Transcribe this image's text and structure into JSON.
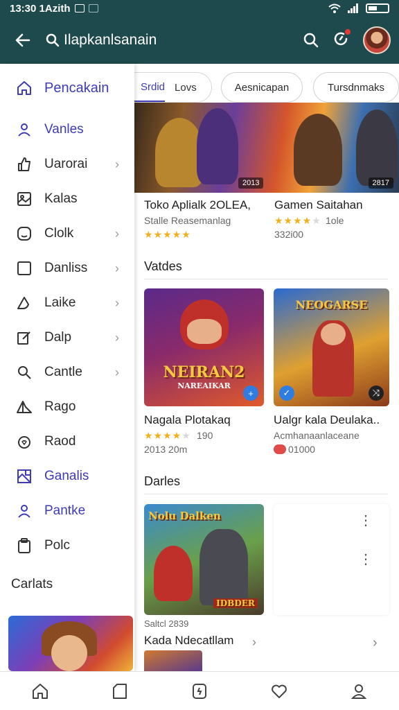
{
  "status_bar": {
    "time": "13:30 1Azith"
  },
  "app_bar": {
    "title": "Ilapkanlsanain"
  },
  "drawer": {
    "header_label": "Pencakain",
    "items": [
      {
        "label": "Vanles",
        "active": true,
        "chevron": false,
        "icon": "person-icon"
      },
      {
        "label": "Uarorai",
        "active": false,
        "chevron": true,
        "icon": "thumb-icon"
      },
      {
        "label": "Kalas",
        "active": false,
        "chevron": false,
        "icon": "image-icon"
      },
      {
        "label": "Clolk",
        "active": false,
        "chevron": true,
        "icon": "face-icon"
      },
      {
        "label": "Danliss",
        "active": false,
        "chevron": true,
        "icon": "square-icon"
      },
      {
        "label": "Laike",
        "active": false,
        "chevron": true,
        "icon": "leaf-icon"
      },
      {
        "label": "Dalp",
        "active": false,
        "chevron": true,
        "icon": "edit-icon"
      },
      {
        "label": "Cantle",
        "active": false,
        "chevron": true,
        "icon": "search-icon"
      },
      {
        "label": "Rago",
        "active": false,
        "chevron": false,
        "icon": "triangle-icon"
      },
      {
        "label": "Raod",
        "active": false,
        "chevron": false,
        "icon": "heart-icon"
      },
      {
        "label": "Ganalis",
        "active": true,
        "chevron": false,
        "icon": "gallery-icon"
      },
      {
        "label": "Pantke",
        "active": true,
        "chevron": false,
        "icon": "person-icon"
      },
      {
        "label": "Polc",
        "active": false,
        "chevron": false,
        "icon": "clipboard-icon"
      }
    ],
    "section_label": "Carlats"
  },
  "chips": {
    "selected": "Srdid",
    "unselected": "Lovs",
    "chip2": "Aesnicapan",
    "chip3": "Tursdnmaks"
  },
  "hero": {
    "badge_left": "2013",
    "badge_right": "2817"
  },
  "featured": [
    {
      "title": "Toko Aplialk 2OLEA,",
      "subtitle": "Stalle Reasemanlag",
      "rating": 5,
      "meta": ""
    },
    {
      "title": "Gamen Saitahan",
      "subtitle": "1ole",
      "rating": 4,
      "meta": "332i00"
    }
  ],
  "section_1": {
    "title": "Vatdes"
  },
  "tiles_row_1": [
    {
      "logo_line1": "NEIRAN2",
      "logo_line2": "NAREAIKAR",
      "title": "Nagala Plotakaq",
      "rating": 4,
      "rating_text": "190",
      "meta": "2013 20m"
    },
    {
      "logo_line1": "NEOGARSE",
      "logo_line2": "",
      "title": "Ualgr kala Deulaka..",
      "subtitle": "Acmhanaanlaceane",
      "meta": "01000"
    }
  ],
  "section_2": {
    "title": "Darles"
  },
  "tiles_row_2": [
    {
      "logo_line1": "Nolu Dalken",
      "logo_line2": "IDBDER",
      "meta": "Saltcl 2839",
      "title": "Kada Ndecatllam"
    }
  ],
  "colors": {
    "app_bar": "#1e4a4d",
    "accent": "#3d3bb5",
    "star": "#f2b01e"
  }
}
